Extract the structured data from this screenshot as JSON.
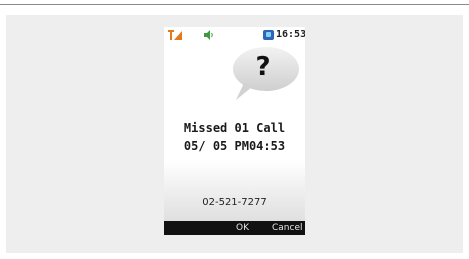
{
  "status_bar": {
    "time": "16:53",
    "signal_icon": "signal-strength-icon",
    "sound_icon": "speaker-icon",
    "app_icon": "phone-app-icon",
    "accent_orange": "#e07a1a",
    "accent_green": "#3d9a3d"
  },
  "notification": {
    "icon_text": "?",
    "title": "Missed 01 Call",
    "datetime": "05/ 05  PM04:53",
    "caller_number": "02-521-7277"
  },
  "softkeys": {
    "ok": "OK",
    "cancel": "Cancel"
  }
}
